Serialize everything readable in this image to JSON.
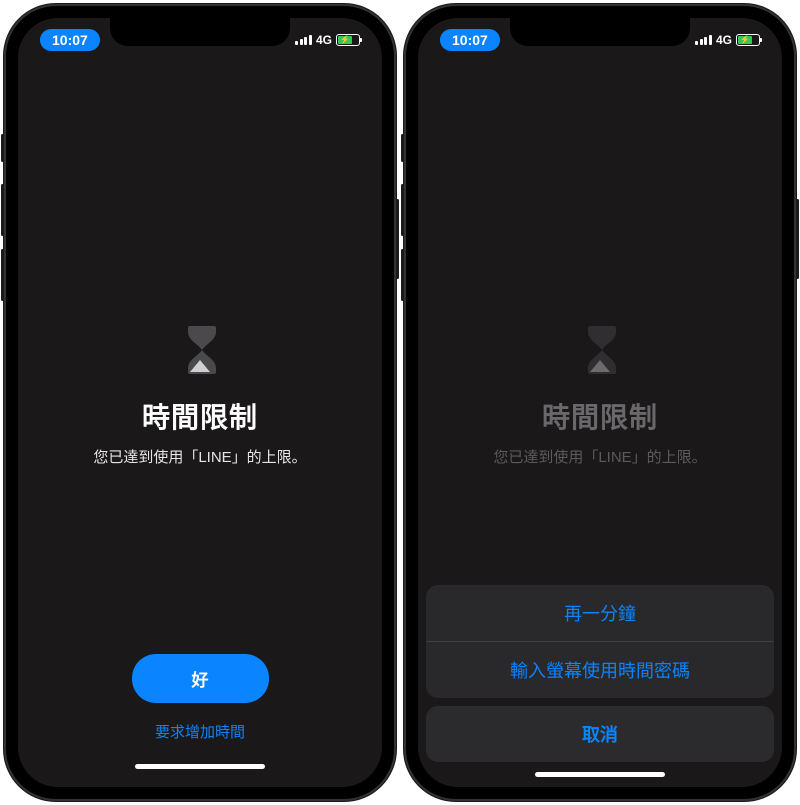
{
  "status": {
    "time": "10:07",
    "network": "4G"
  },
  "left_screen": {
    "title": "時間限制",
    "subtitle": "您已達到使用「LINE」的上限。",
    "ok_label": "好",
    "request_more_time": "要求增加時間"
  },
  "right_screen": {
    "title": "時間限制",
    "subtitle": "您已達到使用「LINE」的上限。",
    "sheet": {
      "one_more_minute": "再一分鐘",
      "enter_passcode": "輸入螢幕使用時間密碼",
      "cancel": "取消"
    }
  }
}
